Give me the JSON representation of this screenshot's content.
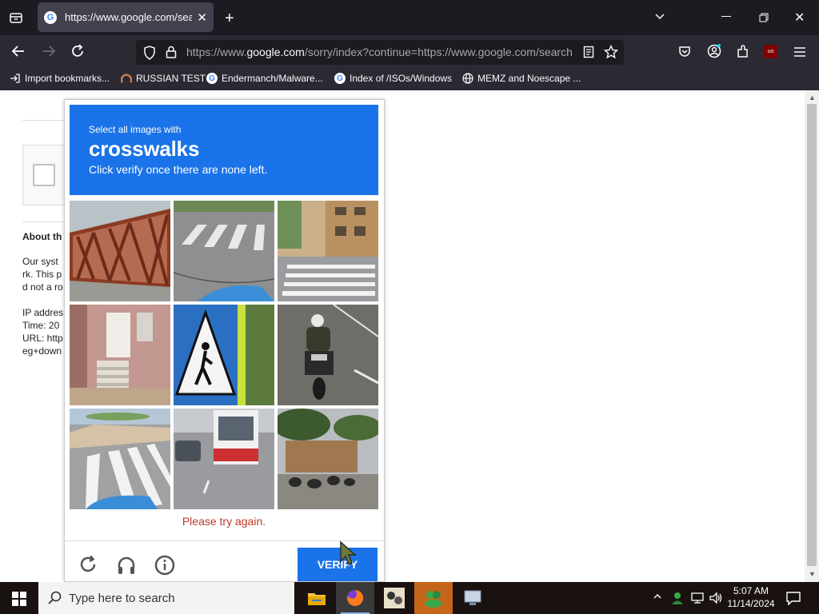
{
  "browser": {
    "tab": {
      "title": "https://www.google.com/search",
      "favicon": "google-favicon"
    },
    "url": {
      "prefix": "https://www.",
      "domain": "google.com",
      "rest": "/sorry/index?continue=https://www.google.com/search"
    },
    "bookmarks": [
      {
        "label": "Import bookmarks...",
        "icon": "import-icon"
      },
      {
        "label": "RUSSIAN TEST",
        "icon": "russian-favicon"
      },
      {
        "label": "Endermanch/Malware...",
        "icon": "google-favicon"
      },
      {
        "label": "Index of /ISOs/Windows",
        "icon": "google-favicon"
      },
      {
        "label": "MEMZ and Noescape ...",
        "icon": "globe-icon"
      }
    ]
  },
  "background_page": {
    "about_heading": "About th",
    "lines": [
      "Our syst",
      "rk. This p",
      "d not a ro"
    ],
    "details": [
      "IP addres",
      "Time: 20",
      "URL: http",
      "eg+down"
    ]
  },
  "captcha": {
    "instruction": "Select all images with",
    "target": "crosswalks",
    "hint": "Click verify once there are none left.",
    "error": "Please try again.",
    "verify_label": "VERIFY",
    "tiles": [
      "bridge",
      "crosswalk",
      "crosswalk",
      "house",
      "pedestrian-sign",
      "motorcycle",
      "crosswalk",
      "bus",
      "street"
    ],
    "colors": {
      "header": "#1a73e8",
      "error": "#c0392b"
    }
  },
  "taskbar": {
    "search_placeholder": "Type here to search",
    "time": "5:07 AM",
    "date": "11/14/2024"
  }
}
